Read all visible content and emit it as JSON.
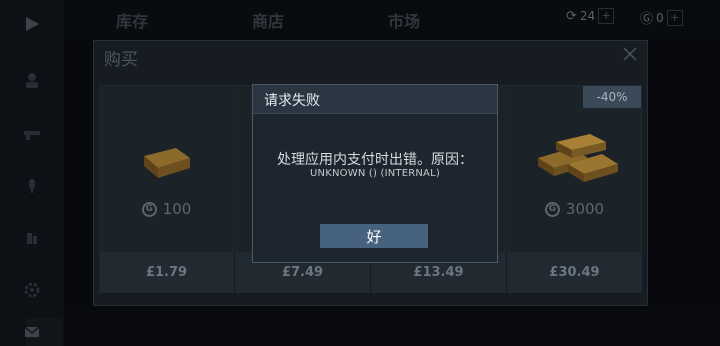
{
  "top_tabs": [
    {
      "label": "库存"
    },
    {
      "label": "商店"
    },
    {
      "label": "市场"
    }
  ],
  "currency": {
    "silver": "24",
    "gold": "0"
  },
  "purchase_dialog": {
    "title": "购买",
    "cards": [
      {
        "amount": "100",
        "price": "£1.79",
        "discount": ""
      },
      {
        "amount": "",
        "price": "£7.49",
        "discount": ""
      },
      {
        "amount": "",
        "price": "£13.49",
        "discount": ""
      },
      {
        "amount": "3000",
        "price": "£30.49",
        "discount": "-40%"
      }
    ]
  },
  "error_dialog": {
    "title": "请求失败",
    "message": "处理应用内支付时出错。原因：",
    "detail": "UNKNOWN () (INTERNAL)",
    "ok_label": "好"
  },
  "colors": {
    "background": "#0c0f13",
    "dialog_bg": "#1d262e",
    "ok_button": "#46627e",
    "gold": "#c89a3a"
  }
}
